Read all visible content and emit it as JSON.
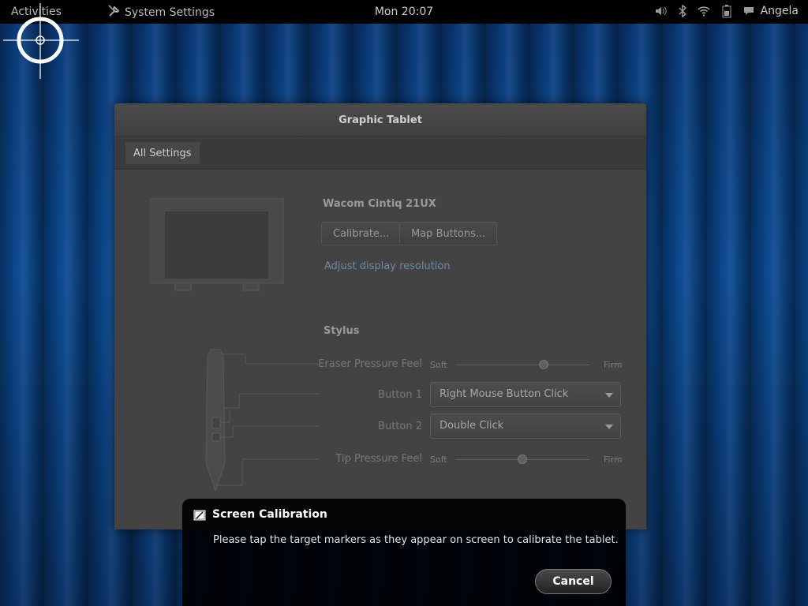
{
  "topbar": {
    "activities": "Activities",
    "app_name": "System Settings",
    "app_icon": "wrench-icon",
    "clock": "Mon 20:07",
    "tray_icons": [
      "volume-icon",
      "bluetooth-icon",
      "wifi-icon",
      "battery-icon"
    ],
    "user": "Angela"
  },
  "window": {
    "title": "Graphic Tablet",
    "all_settings": "All Settings",
    "device_name": "Wacom Cintiq 21UX",
    "calibrate_label": "Calibrate...",
    "map_buttons_label": "Map Buttons...",
    "adjust_link": "Adjust display resolution",
    "stylus_heading": "Stylus",
    "eraser_label": "Eraser Pressure Feel",
    "eraser_soft": "Soft",
    "eraser_firm": "Firm",
    "eraser_level": 0.66,
    "button1_label": "Button 1",
    "button1_value": "Right Mouse Button Click",
    "button2_label": "Button 2",
    "button2_value": "Double Click",
    "tip_label": "Tip Pressure Feel",
    "tip_soft": "Soft",
    "tip_firm": "Firm",
    "tip_level": 0.5
  },
  "notification": {
    "title": "Screen Calibration",
    "body": "Please tap the target markers as they appear on screen to calibrate the tablet.",
    "cancel": "Cancel"
  },
  "colors": {
    "accent_link": "#6f89a8",
    "panel_bg": "#000000"
  }
}
